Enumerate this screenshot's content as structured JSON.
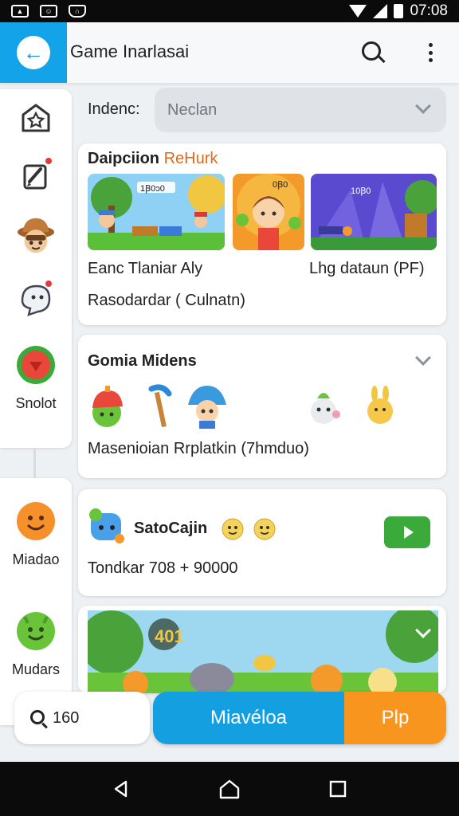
{
  "status_bar": {
    "time": "07:08",
    "left_icons": [
      "image-icon",
      "robot-icon",
      "shield-icon"
    ],
    "right_icons": [
      "wifi-icon",
      "signal-icon",
      "battery-icon"
    ]
  },
  "app_bar": {
    "title": "Game Inarlasai",
    "back_icon": "arrow-left-icon",
    "search_icon": "search-icon",
    "menu_icon": "more-vertical-icon",
    "accent_color": "#12a3e8"
  },
  "sidebar": {
    "top_items": [
      {
        "icon": "star-house-icon",
        "label": ""
      },
      {
        "icon": "edit-note-icon",
        "label": "",
        "badge": true
      },
      {
        "icon": "explorer-avatar-icon",
        "label": ""
      },
      {
        "icon": "ghost-icon",
        "label": "",
        "badge": true
      },
      {
        "icon": "heart-apple-icon",
        "label": "Snolot"
      }
    ],
    "bottom_items": [
      {
        "icon": "orange-smiley-icon",
        "label": "Miadao"
      },
      {
        "icon": "green-smiley-icon",
        "label": "Mudars"
      }
    ]
  },
  "filter": {
    "label": "Indenc:",
    "value": "Neclan"
  },
  "featured": {
    "title": "Daipciion",
    "title_accent": "ReHurk",
    "thumbs": [
      {
        "badge": "1Ꞵ0ɔ0",
        "scene": "forest-platformer"
      },
      {
        "badge": "0Ꞵ0",
        "scene": "character-portrait"
      },
      {
        "badge": "10Ꞵ0",
        "scene": "night-city"
      }
    ],
    "caption_left": "Eanc Tlaniar Aly",
    "caption_right": "Lhg dataun (PF)",
    "caption_bottom": "Rasodardar ( Culnatn)"
  },
  "members": {
    "title": "Gomia Midens",
    "characters": [
      "red-helmet-blob",
      "blue-pickaxe",
      "blue-mushroom-kid",
      "sprout-creature",
      "yellow-bunny"
    ],
    "caption": "Masenioian  Rrplatkin (7hmduo)"
  },
  "player": {
    "name": "SatoCajin",
    "stats": "Tondkar 708 + 90000",
    "play_icon": "play-icon",
    "play_color": "#3aaa3a"
  },
  "banner": {
    "badge": "401",
    "scene": "forest-creatures"
  },
  "bottom_bar": {
    "search_value": "160",
    "main_label": "Miavéloa",
    "secondary_label": "Plp",
    "main_color": "#14a0e0",
    "secondary_color": "#f7951e"
  },
  "nav_bar": {
    "icons": [
      "nav-back-icon",
      "nav-home-icon",
      "nav-recent-icon"
    ]
  }
}
